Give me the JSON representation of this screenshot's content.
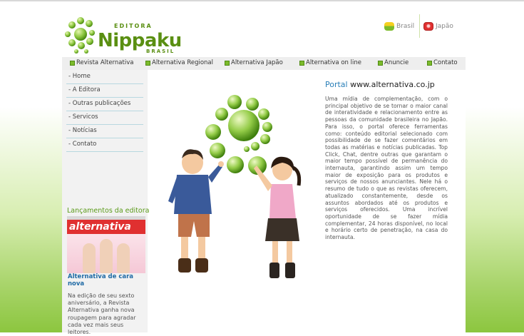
{
  "brand": {
    "top_text": "EDITORA",
    "name": "Nippaku",
    "bottom_text": "BRASIL"
  },
  "languages": [
    {
      "label": "Brasil",
      "flag_color": "#7cbb2c"
    },
    {
      "label": "Japão",
      "flag_color": "#e03030"
    }
  ],
  "nav": {
    "items": [
      {
        "label": "Revista Alternativa"
      },
      {
        "label": "Alternativa Regional"
      },
      {
        "label": "Alternativa Japão"
      },
      {
        "label": "Alternativa on line"
      },
      {
        "label": "Anuncie"
      },
      {
        "label": "Contato"
      }
    ]
  },
  "sidebar": {
    "items": [
      {
        "label": "- Home"
      },
      {
        "label": "- A Editora"
      },
      {
        "label": "- Outras publicações"
      },
      {
        "label": "- Servicos"
      },
      {
        "label": "- Notícias"
      },
      {
        "label": "- Contato"
      }
    ],
    "launch_title": "Lançamentos da editora",
    "magazine": {
      "title": "alternativa",
      "caption": "Alternativa de cara nova",
      "text": "Na edição de seu sexto aniversário, a Revista Alternativa ganha nova roupagem para agradar cada vez mais seus leitores."
    }
  },
  "main": {
    "title_prefix": "Portal",
    "title_site": "www.alternativa.co.jp",
    "text": "Uma mídia de complementação, com o principal objetivo de se tornar o maior canal de interatividade e relacionamento entre as pessoas da comunidade brasileira no Japão. Para isso, o portal oferece ferramentas como: conteúdo editorial selecionado com possibilidade de se fazer comentários em todas as matérias e notícias publicadas. Top Click, Chat, dentre outras que garantam o maior tempo possível de permanência do internauta, garantindo assim um tempo maior de exposição para os produtos e serviços de nossos anunciantes. Nele há o resumo de tudo o que as revistas oferecem, atualizado constantemente, desde os assuntos abordados até os produtos e serviços oferecidos. Uma incrível oportunidade de se fazer mídia complementar, 24 horas disponível, no local e horário certo de penetração, na casa do internauta."
  },
  "colors": {
    "brand_green": "#5a8f12",
    "link_blue": "#1f6aa5"
  }
}
